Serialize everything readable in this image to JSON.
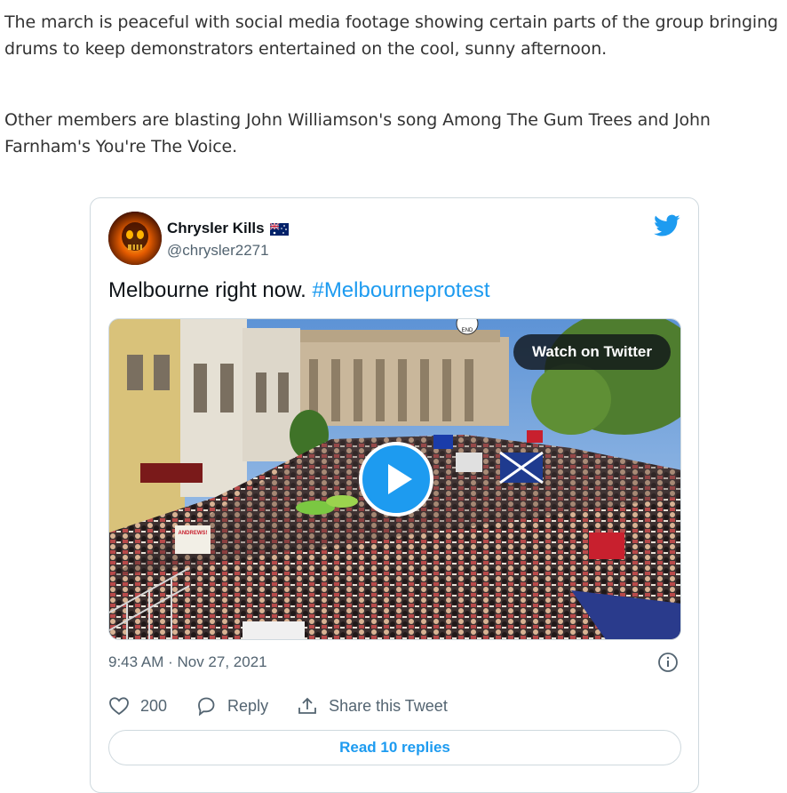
{
  "article": {
    "paragraph1": "The march is peaceful with social media footage showing certain parts of the group bringing drums to keep demonstrators entertained on the cool, sunny afternoon.",
    "paragraph2": "Other members are blasting John Williamson's song Among The Gum Trees and John Farnham's You're The Voice."
  },
  "tweet": {
    "author_name": "Chrysler Kills",
    "author_flag": "australia-flag-icon",
    "author_handle": "@chrysler2271",
    "text": "Melbourne right now.",
    "hashtag": "#Melbourneprotest",
    "watch_label": "Watch on Twitter",
    "timestamp": "9:43 AM · Nov 27, 2021",
    "likes": "200",
    "reply_label": "Reply",
    "share_label": "Share this Tweet",
    "read_replies_label": "Read 10 replies",
    "sign_text": "END",
    "protest_sign_text": "ANDREWS!",
    "colors": {
      "accent": "#1d9bf0",
      "text": "#0f1419",
      "muted": "#536471",
      "border": "#cfd9de"
    }
  }
}
